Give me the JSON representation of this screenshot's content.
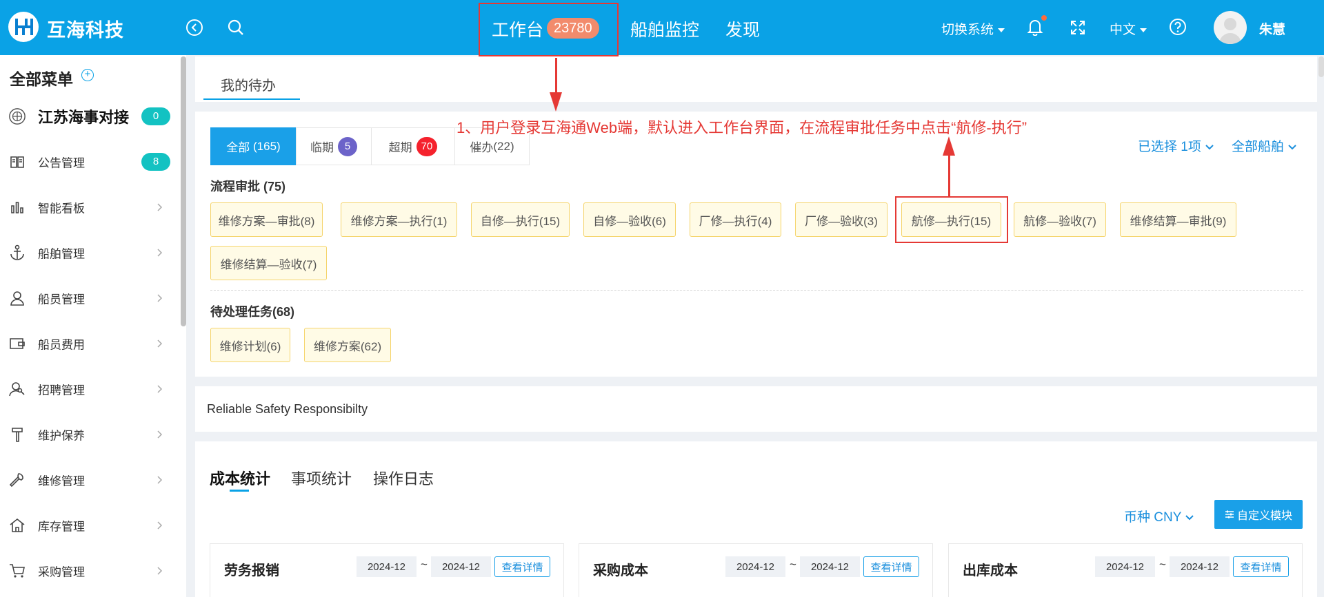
{
  "header": {
    "logo_text": "互海科技",
    "nav": [
      {
        "label": "工作台",
        "badge": "23780"
      },
      {
        "label": "船舶监控"
      },
      {
        "label": "发现"
      }
    ],
    "switch_system": "切换系统",
    "language": "中文",
    "username": "朱慧"
  },
  "sidebar": {
    "title": "全部菜单",
    "items": [
      {
        "label": "江苏海事对接",
        "badge": "0",
        "icon": "emblem-icon"
      },
      {
        "label": "公告管理",
        "badge": "8",
        "icon": "book-icon"
      },
      {
        "label": "智能看板",
        "icon": "bar-chart-icon"
      },
      {
        "label": "船舶管理",
        "icon": "anchor-icon"
      },
      {
        "label": "船员管理",
        "icon": "user-icon"
      },
      {
        "label": "船员费用",
        "icon": "wallet-icon"
      },
      {
        "label": "招聘管理",
        "icon": "user-search-icon"
      },
      {
        "label": "维护保养",
        "icon": "hammer-icon"
      },
      {
        "label": "维修管理",
        "icon": "wrench-icon"
      },
      {
        "label": "库存管理",
        "icon": "home-icon"
      },
      {
        "label": "采购管理",
        "icon": "cart-icon"
      }
    ]
  },
  "todo": {
    "tab_label": "我的待办",
    "filters": [
      {
        "label": "全部",
        "count": "(165)"
      },
      {
        "label": "临期",
        "badge": "5",
        "badge_color": "#6c63c9"
      },
      {
        "label": "超期",
        "badge": "70",
        "badge_color": "#f5222d"
      },
      {
        "label": "催办",
        "count": "(22)"
      }
    ],
    "selected": "已选择 1项",
    "all_ships": "全部船舶",
    "annotation": "1、用户登录互海通Web端，默认进入工作台界面，在流程审批任务中点击“航修-执行”",
    "approval_title": "流程审批 (75)",
    "approval_chips": [
      "维修方案—审批(8)",
      "维修方案—执行(1)",
      "自修—执行(15)",
      "自修—验收(6)",
      "厂修—执行(4)",
      "厂修—验收(3)",
      "航修—执行(15)",
      "航修—验收(7)",
      "维修结算—审批(9)",
      "维修结算—验收(7)"
    ],
    "pending_title": "待处理任务(68)",
    "pending_chips": [
      "维修计划(6)",
      "维修方案(62)"
    ]
  },
  "banner": {
    "text": "Reliable Safety Responsibilty"
  },
  "stats": {
    "tabs": [
      "成本统计",
      "事项统计",
      "操作日志"
    ],
    "currency": "币种 CNY",
    "custom_module": "自定义模块",
    "cards": [
      {
        "title": "劳务报销",
        "from": "2024-12",
        "to": "2024-12",
        "detail": "查看详情"
      },
      {
        "title": "采购成本",
        "from": "2024-12",
        "to": "2024-12",
        "detail": "查看详情"
      },
      {
        "title": "出库成本",
        "from": "2024-12",
        "to": "2024-12",
        "detail": "查看详情"
      }
    ]
  },
  "colors": {
    "primary": "#0aa2e6",
    "annotation": "#e53935",
    "chip_bg": "#fffbe6",
    "chip_border": "#f5d46b",
    "teal_badge": "#13c2c2"
  }
}
